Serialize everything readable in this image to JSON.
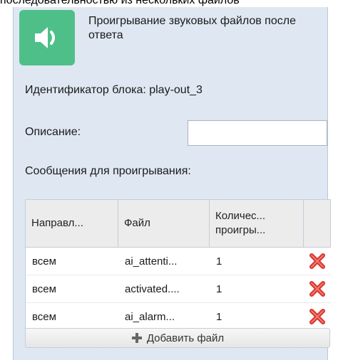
{
  "header_text": "последовательностью из нескольких файлов",
  "block": {
    "title": "Проигрывание звуковых файлов после ответа",
    "icon": "speaker-icon",
    "accent_color": "#4fbf8a"
  },
  "block_id": {
    "label": "Идентификатор блока: play-out_3"
  },
  "description": {
    "label": "Описание:",
    "value": ""
  },
  "messages": {
    "label": "Сообщения для проигрывания:",
    "columns": [
      "Направл...",
      "Файл",
      "Количес... проигры...",
      ""
    ],
    "rows": [
      {
        "direction": "всем",
        "file": "ai_attenti...",
        "count": "1"
      },
      {
        "direction": "всем",
        "file": "activated....",
        "count": "1"
      },
      {
        "direction": "всем",
        "file": "ai_alarm...",
        "count": "1"
      }
    ],
    "delete_icon": "delete-icon",
    "delete_color": "#d9342b"
  },
  "add_file": {
    "label": "Добавить файл",
    "icon": "plus-icon"
  }
}
